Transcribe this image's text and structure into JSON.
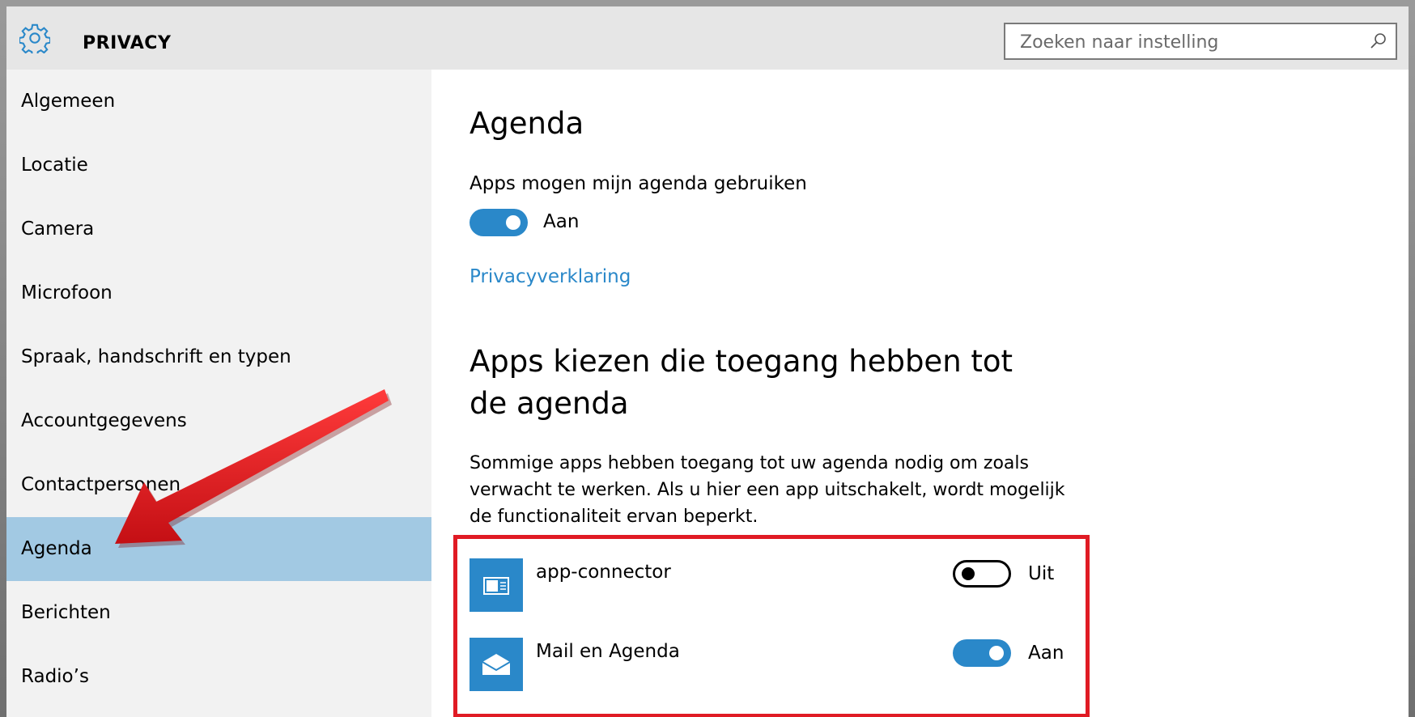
{
  "header": {
    "icon": "gear-icon",
    "title": "PRIVACY",
    "search": {
      "placeholder": "Zoeken naar instelling",
      "value": "",
      "icon": "search-icon"
    }
  },
  "sidebar": {
    "items": [
      {
        "label": "Algemeen"
      },
      {
        "label": "Locatie"
      },
      {
        "label": "Camera"
      },
      {
        "label": "Microfoon"
      },
      {
        "label": "Spraak, handschrift en typen"
      },
      {
        "label": "Accountgegevens"
      },
      {
        "label": "Contactpersonen"
      },
      {
        "label": "Agenda",
        "selected": true
      },
      {
        "label": "Berichten"
      },
      {
        "label": "Radio’s"
      }
    ]
  },
  "main": {
    "title": "Agenda",
    "access_label": "Apps mogen mijn agenda gebruiken",
    "access_toggle": {
      "state": "on",
      "label": "Aan"
    },
    "privacy_link": "Privacyverklaring",
    "apps_heading": "Apps kiezen die toegang hebben tot de agenda",
    "apps_description": "Sommige apps hebben toegang tot uw agenda nodig om zoals verwacht te werken. Als u hier een app uitschakelt, wordt mogelijk de functionaliteit ervan beperkt.",
    "apps": [
      {
        "name": "app-connector",
        "icon": "app-connector-icon",
        "state": "off",
        "state_label": "Uit"
      },
      {
        "name": "Mail en Agenda",
        "icon": "mail-icon",
        "state": "on",
        "state_label": "Aan"
      }
    ]
  },
  "colors": {
    "accent": "#2a88c9",
    "selected_nav": "#a2c9e3",
    "header_bg": "#e6e6e6",
    "sidebar_bg": "#f2f2f2",
    "highlight_box": "#e01b24",
    "annotation_arrow": "#e8161b"
  }
}
